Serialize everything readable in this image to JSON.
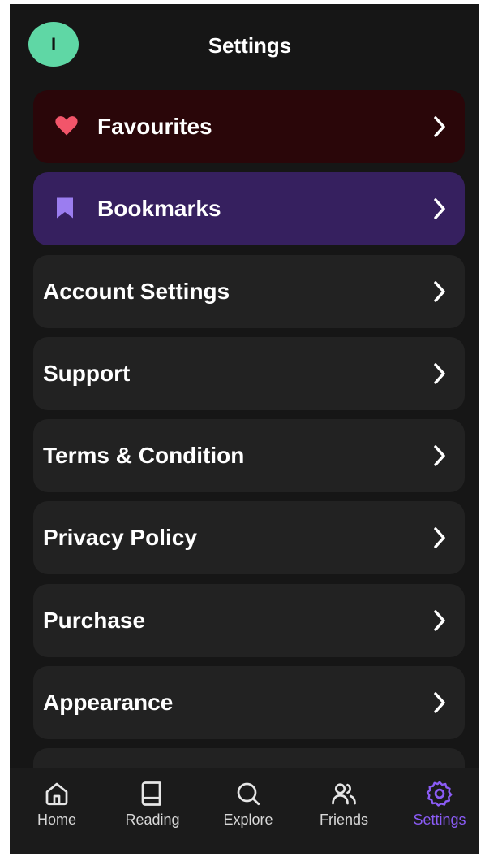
{
  "header": {
    "title": "Settings",
    "avatar_initial": "I"
  },
  "menu": [
    {
      "label": "Favourites",
      "icon": "heart-icon",
      "bg": "#2a0609",
      "icon_color": "#f2556a"
    },
    {
      "label": "Bookmarks",
      "icon": "bookmark-icon",
      "bg": "#36205f",
      "icon_color": "#9b7df0"
    },
    {
      "label": "Account Settings"
    },
    {
      "label": "Support"
    },
    {
      "label": "Terms & Condition"
    },
    {
      "label": "Privacy Policy"
    },
    {
      "label": "Purchase"
    },
    {
      "label": "Appearance"
    }
  ],
  "nav": [
    {
      "label": "Home",
      "icon": "home-icon"
    },
    {
      "label": "Reading",
      "icon": "book-icon"
    },
    {
      "label": "Explore",
      "icon": "search-icon"
    },
    {
      "label": "Friends",
      "icon": "friends-icon"
    },
    {
      "label": "Settings",
      "icon": "gear-icon",
      "active": true
    }
  ],
  "colors": {
    "accent": "#8b5cf6",
    "avatar": "#5fd7a5",
    "background": "#161616"
  }
}
